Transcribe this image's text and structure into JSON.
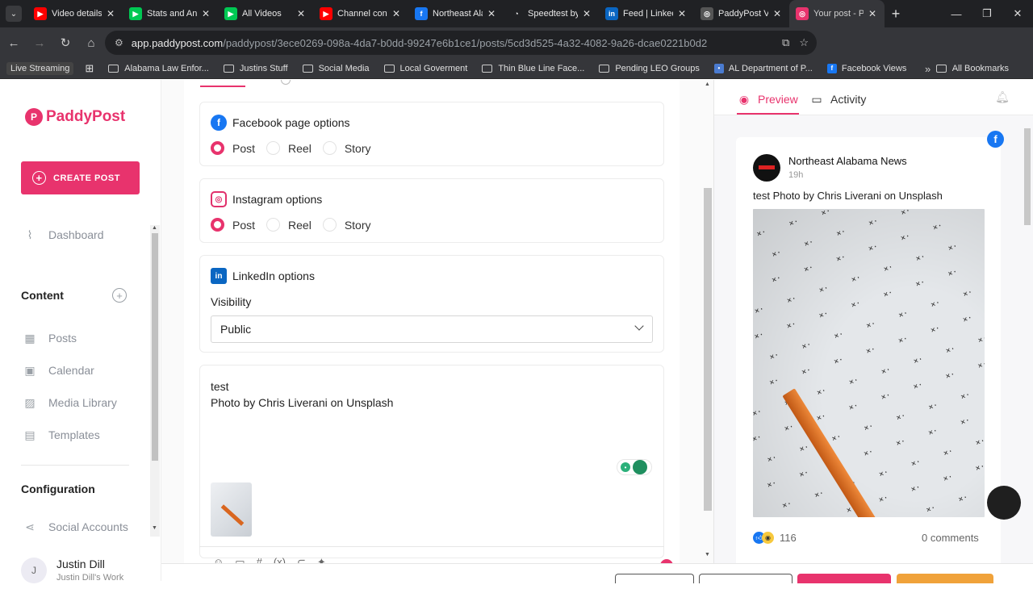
{
  "browser": {
    "tabs": [
      {
        "title": "Video details",
        "fav_color": "#ff0000",
        "fav_glyph": "▶"
      },
      {
        "title": "Stats and Ana",
        "fav_color": "#00c853",
        "fav_glyph": "▶"
      },
      {
        "title": "All Videos",
        "fav_color": "#00c853",
        "fav_glyph": "▶"
      },
      {
        "title": "Channel cont",
        "fav_color": "#ff0000",
        "fav_glyph": "▶"
      },
      {
        "title": "Northeast Ala",
        "fav_color": "#1877f2",
        "fav_glyph": "f"
      },
      {
        "title": "Speedtest by",
        "fav_color": "#202124",
        "fav_glyph": "◔"
      },
      {
        "title": "Feed | Linked",
        "fav_color": "#0a66c2",
        "fav_glyph": "in"
      },
      {
        "title": "PaddyPost Vi",
        "fav_color": "#555555",
        "fav_glyph": "◎"
      },
      {
        "title": "Your post - P",
        "fav_color": "#e8336d",
        "fav_glyph": "◎"
      }
    ],
    "url_host": "app.paddypost.com",
    "url_path": "/paddypost/3ece0269-098a-4da7-b0dd-99247e6b1ce1/posts/5cd3d525-4a32-4082-9a26-dcae0221b0d2",
    "bookmarks": [
      {
        "label": "Live Streaming",
        "kind": "live"
      },
      {
        "label": "Alabama Law Enfor...",
        "kind": "folder"
      },
      {
        "label": "Justins Stuff",
        "kind": "folder"
      },
      {
        "label": "Social Media",
        "kind": "folder"
      },
      {
        "label": "Local Goverment",
        "kind": "folder"
      },
      {
        "label": "Thin Blue Line Face...",
        "kind": "folder"
      },
      {
        "label": "Pending LEO Groups",
        "kind": "folder"
      },
      {
        "label": "AL Department of P...",
        "kind": "site"
      },
      {
        "label": "Facebook Views",
        "kind": "facebook"
      }
    ],
    "all_bookmarks": "All Bookmarks"
  },
  "sidebar": {
    "logo": "PaddyPost",
    "create_post": "CREATE POST",
    "dashboard": "Dashboard",
    "content_heading": "Content",
    "content_items": [
      "Posts",
      "Calendar",
      "Media Library",
      "Templates"
    ],
    "configuration_heading": "Configuration",
    "social_accounts": "Social Accounts",
    "user_initial": "J",
    "user_name": "Justin Dill",
    "workspace": "Justin Dill's Work"
  },
  "editor": {
    "facebook_heading": "Facebook page options",
    "instagram_heading": "Instagram options",
    "linkedin_heading": "LinkedIn options",
    "post_types": [
      "Post",
      "Reel",
      "Story"
    ],
    "selected_type": "Post",
    "visibility_label": "Visibility",
    "visibility_value": "Public",
    "post_line1": "test",
    "post_line2": "Photo by Chris Liverani on Unsplash"
  },
  "preview": {
    "tab_preview": "Preview",
    "tab_activity": "Activity",
    "page_name": "Northeast Alabama News",
    "time_ago": "19h",
    "caption": "test Photo by Chris Liverani on Unsplash",
    "reaction_count": "116",
    "comments": "0 comments"
  },
  "colors": {
    "brand": "#e8336d",
    "facebook": "#1877f2",
    "linkedin": "#0a66c2"
  }
}
